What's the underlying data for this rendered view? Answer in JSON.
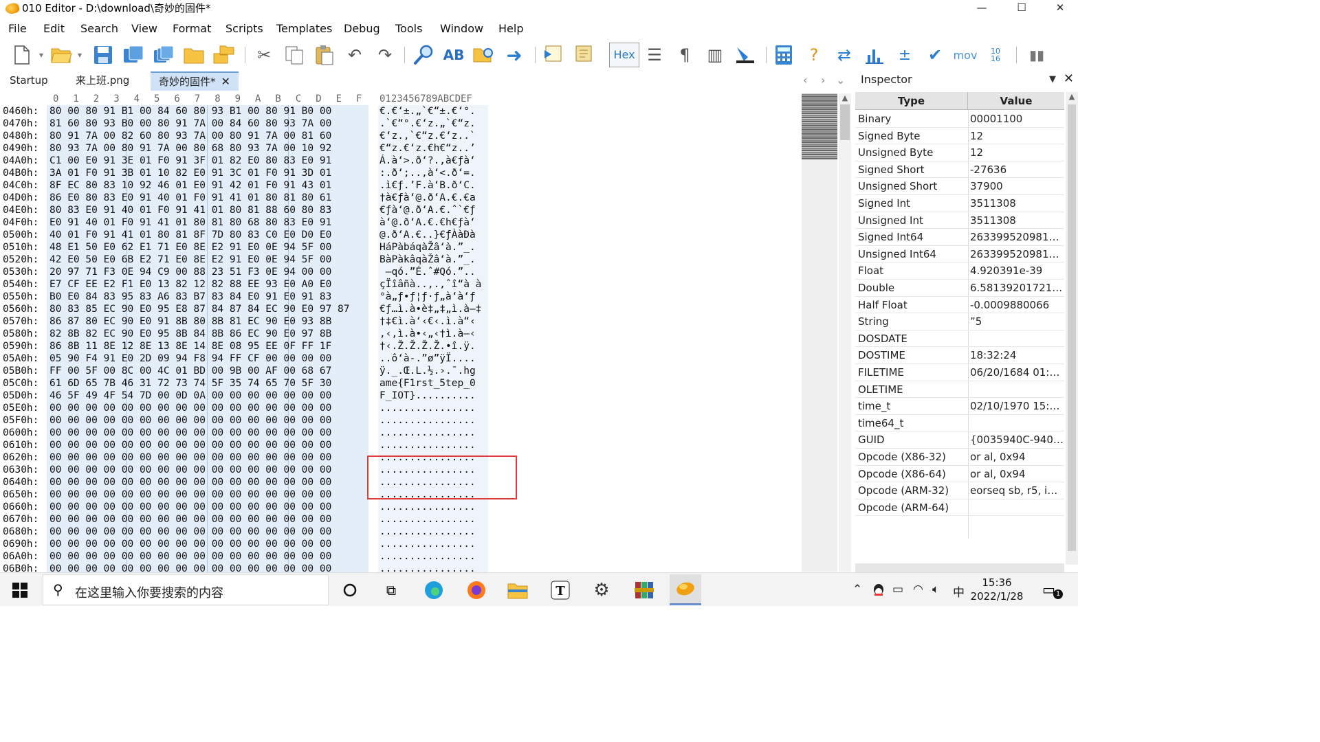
{
  "window": {
    "title": "010 Editor - D:\\download\\奇妙的固件*",
    "minimize": "—",
    "maximize": "☐",
    "close": "✕"
  },
  "menu": [
    "File",
    "Edit",
    "Search",
    "View",
    "Format",
    "Scripts",
    "Templates",
    "Debug",
    "Tools",
    "Window",
    "Help"
  ],
  "toolbar": {
    "hex_label": "Hex",
    "mov_label": "mov",
    "base_label": "10\n16"
  },
  "tabs": [
    {
      "label": "Startup"
    },
    {
      "label": "来上班.png"
    },
    {
      "label": "奇妙的固件*",
      "active": true,
      "close": "✕"
    }
  ],
  "editor": {
    "col_headers": [
      "0",
      "1",
      "2",
      "3",
      "4",
      "5",
      "6",
      "7",
      "8",
      "9",
      "A",
      "B",
      "C",
      "D",
      "E",
      "F"
    ],
    "ascii_header": "0123456789ABCDEF",
    "rows": [
      {
        "addr": "0460h:",
        "bytes": "80 00 80 91 B1 00 84 60 80 93 B1 00 80 91 B0 00",
        "ascii": "€.€‘±.„`€“±.€‘°."
      },
      {
        "addr": "0470h:",
        "bytes": "81 60 80 93 B0 00 80 91 7A 00 84 60 80 93 7A 00",
        "ascii": ".`€“°.€‘z.„`€“z."
      },
      {
        "addr": "0480h:",
        "bytes": "80 91 7A 00 82 60 80 93 7A 00 80 91 7A 00 81 60",
        "ascii": "€‘z.‚`€“z.€‘z..`"
      },
      {
        "addr": "0490h:",
        "bytes": "80 93 7A 00 80 91 7A 00 80 68 80 93 7A 00 10 92",
        "ascii": "€“z.€‘z.€h€“z..’"
      },
      {
        "addr": "04A0h:",
        "bytes": "C1 00 E0 91 3E 01 F0 91 3F 01 82 E0 80 83 E0 91",
        "ascii": "Á.à‘>.ð‘?.‚à€ƒà‘"
      },
      {
        "addr": "04B0h:",
        "bytes": "3A 01 F0 91 3B 01 10 82 E0 91 3C 01 F0 91 3D 01",
        "ascii": ":.ð‘;..‚à‘<.ð‘=."
      },
      {
        "addr": "04C0h:",
        "bytes": "8F EC 80 83 10 92 46 01 E0 91 42 01 F0 91 43 01",
        "ascii": ".ì€ƒ.’F.à‘B.ð‘C."
      },
      {
        "addr": "04D0h:",
        "bytes": "86 E0 80 83 E0 91 40 01 F0 91 41 01 80 81 80 61",
        "ascii": "†à€ƒà‘@.ð‘A.€.€a"
      },
      {
        "addr": "04E0h:",
        "bytes": "80 83 E0 91 40 01 F0 91 41 01 80 81 88 60 80 83",
        "ascii": "€ƒà‘@.ð‘A.€.ˆ`€ƒ"
      },
      {
        "addr": "04F0h:",
        "bytes": "E0 91 40 01 F0 91 41 01 80 81 80 68 80 83 E0 91",
        "ascii": "à‘@.ð‘A.€.€h€ƒà‘"
      },
      {
        "addr": "0500h:",
        "bytes": "40 01 F0 91 41 01 80 81 8F 7D 80 83 C0 E0 D0 E0",
        "ascii": "@.ð‘A.€..}€ƒÀàÐà"
      },
      {
        "addr": "0510h:",
        "bytes": "48 E1 50 E0 62 E1 71 E0 8E E2 91 E0 0E 94 5F 00",
        "ascii": "HáPàbáqàŽâ‘à.”_."
      },
      {
        "addr": "0520h:",
        "bytes": "42 E0 50 E0 6B E2 71 E0 8E E2 91 E0 0E 94 5F 00",
        "ascii": "BàPàkâqàŽâ‘à.”_."
      },
      {
        "addr": "0530h:",
        "bytes": "20 97 71 F3 0E 94 C9 00 88 23 51 F3 0E 94 00 00",
        "ascii": " —qó.”É.ˆ#Qó.”.."
      },
      {
        "addr": "0540h:",
        "bytes": "E7 CF EE E2 F1 E0 13 82 12 82 88 EE 93 E0 A0 E0",
        "ascii": "çÏîâñà..‚.‚ˆî“à à"
      },
      {
        "addr": "0550h:",
        "bytes": "B0 E0 84 83 95 83 A6 83 B7 83 84 E0 91 E0 91 83",
        "ascii": "°à„ƒ•ƒ¦ƒ·ƒ„à‘à‘ƒ"
      },
      {
        "addr": "0560h:",
        "bytes": "80 83 85 EC 90 E0 95 E8 87 84 87 84 EC 90 E0 97 87",
        "ascii": "€ƒ…ì.à•è‡„‡„ì.à—‡"
      },
      {
        "addr": "0570h:",
        "bytes": "86 87 80 EC 90 E0 91 8B 80 8B 81 EC 90 E0 93 8B",
        "ascii": "†‡€ì.à‘‹€‹.ì.à“‹"
      },
      {
        "addr": "0580h:",
        "bytes": "82 8B 82 EC 90 E0 95 8B 84 8B 86 EC 90 E0 97 8B",
        "ascii": "‚‹‚ì.à•‹„‹†ì.à—‹"
      },
      {
        "addr": "0590h:",
        "bytes": "86 8B 11 8E 12 8E 13 8E 14 8E 08 95 EE 0F FF 1F",
        "ascii": "†‹.Ž.Ž.Ž.Ž.•î.ÿ."
      },
      {
        "addr": "05A0h:",
        "bytes": "05 90 F4 91 E0 2D 09 94 F8 94 FF CF 00 00 00 00",
        "ascii": "..ô‘à-.”ø”ÿÏ...."
      },
      {
        "addr": "05B0h:",
        "bytes": "FF 00 5F 00 8C 00 4C 01 BD 00 9B 00 AF 00 68 67",
        "ascii": "ÿ._.Œ.L.½.›.¯.hg"
      },
      {
        "addr": "05C0h:",
        "bytes": "61 6D 65 7B 46 31 72 73 74 5F 35 74 65 70 5F 30",
        "ascii": "ame{F1rst_5tep_0"
      },
      {
        "addr": "05D0h:",
        "bytes": "46 5F 49 4F 54 7D 00 0D 0A 00 00 00 00 00 00 00",
        "ascii": "F_IOT}.........."
      },
      {
        "addr": "05E0h:",
        "bytes": "00 00 00 00 00 00 00 00 00 00 00 00 00 00 00 00",
        "ascii": "................"
      },
      {
        "addr": "05F0h:",
        "bytes": "00 00 00 00 00 00 00 00 00 00 00 00 00 00 00 00",
        "ascii": "................"
      },
      {
        "addr": "0600h:",
        "bytes": "00 00 00 00 00 00 00 00 00 00 00 00 00 00 00 00",
        "ascii": "................"
      },
      {
        "addr": "0610h:",
        "bytes": "00 00 00 00 00 00 00 00 00 00 00 00 00 00 00 00",
        "ascii": "................"
      },
      {
        "addr": "0620h:",
        "bytes": "00 00 00 00 00 00 00 00 00 00 00 00 00 00 00 00",
        "ascii": "................"
      },
      {
        "addr": "0630h:",
        "bytes": "00 00 00 00 00 00 00 00 00 00 00 00 00 00 00 00",
        "ascii": "................"
      },
      {
        "addr": "0640h:",
        "bytes": "00 00 00 00 00 00 00 00 00 00 00 00 00 00 00 00",
        "ascii": "................"
      },
      {
        "addr": "0650h:",
        "bytes": "00 00 00 00 00 00 00 00 00 00 00 00 00 00 00 00",
        "ascii": "................"
      },
      {
        "addr": "0660h:",
        "bytes": "00 00 00 00 00 00 00 00 00 00 00 00 00 00 00 00",
        "ascii": "................"
      },
      {
        "addr": "0670h:",
        "bytes": "00 00 00 00 00 00 00 00 00 00 00 00 00 00 00 00",
        "ascii": "................"
      },
      {
        "addr": "0680h:",
        "bytes": "00 00 00 00 00 00 00 00 00 00 00 00 00 00 00 00",
        "ascii": "................"
      },
      {
        "addr": "0690h:",
        "bytes": "00 00 00 00 00 00 00 00 00 00 00 00 00 00 00 00",
        "ascii": "................"
      },
      {
        "addr": "06A0h:",
        "bytes": "00 00 00 00 00 00 00 00 00 00 00 00 00 00 00 00",
        "ascii": "................"
      },
      {
        "addr": "06B0h:",
        "bytes": "00 00 00 00 00 00 00 00 00 00 00 00 00 00 00 00",
        "ascii": "................"
      }
    ]
  },
  "inspector": {
    "title": "Inspector",
    "pin": "▼",
    "close": "✕",
    "col_type": "Type",
    "col_value": "Value",
    "rows": [
      {
        "type": "Binary",
        "value": "00001100"
      },
      {
        "type": "Signed Byte",
        "value": "12"
      },
      {
        "type": "Unsigned Byte",
        "value": "12"
      },
      {
        "type": "Signed Short",
        "value": "-27636"
      },
      {
        "type": "Unsigned Short",
        "value": "37900"
      },
      {
        "type": "Signed Int",
        "value": "3511308"
      },
      {
        "type": "Unsigned Int",
        "value": "3511308"
      },
      {
        "type": "Signed Int64",
        "value": "263399520981207..."
      },
      {
        "type": "Unsigned Int64",
        "value": "263399520981207..."
      },
      {
        "type": "Float",
        "value": "4.920391e-39"
      },
      {
        "type": "Double",
        "value": "6.5813920172107..."
      },
      {
        "type": "Half Float",
        "value": "-0.0009880066"
      },
      {
        "type": "String",
        "value": "”5"
      },
      {
        "type": "DOSDATE",
        "value": ""
      },
      {
        "type": "DOSTIME",
        "value": "18:32:24"
      },
      {
        "type": "FILETIME",
        "value": "06/20/1684 01:20:..."
      },
      {
        "type": "OLETIME",
        "value": ""
      },
      {
        "type": "time_t",
        "value": "02/10/1970 15:21:..."
      },
      {
        "type": "time64_t",
        "value": ""
      },
      {
        "type": "GUID",
        "value": "{0035940C-940C-..."
      },
      {
        "type": "Opcode (X86-32)",
        "value": "or al, 0x94"
      },
      {
        "type": "Opcode (X86-64)",
        "value": "or al, 0x94"
      },
      {
        "type": "Opcode (ARM-32)",
        "value": "eorseq sb, r5, ip, l..."
      },
      {
        "type": "Opcode (ARM-64)",
        "value": ""
      }
    ]
  },
  "taskbar": {
    "search_placeholder": "在这里输入你要搜索的内容",
    "ime": "中",
    "time": "15:36",
    "date": "2022/1/28",
    "notif_count": "1"
  }
}
